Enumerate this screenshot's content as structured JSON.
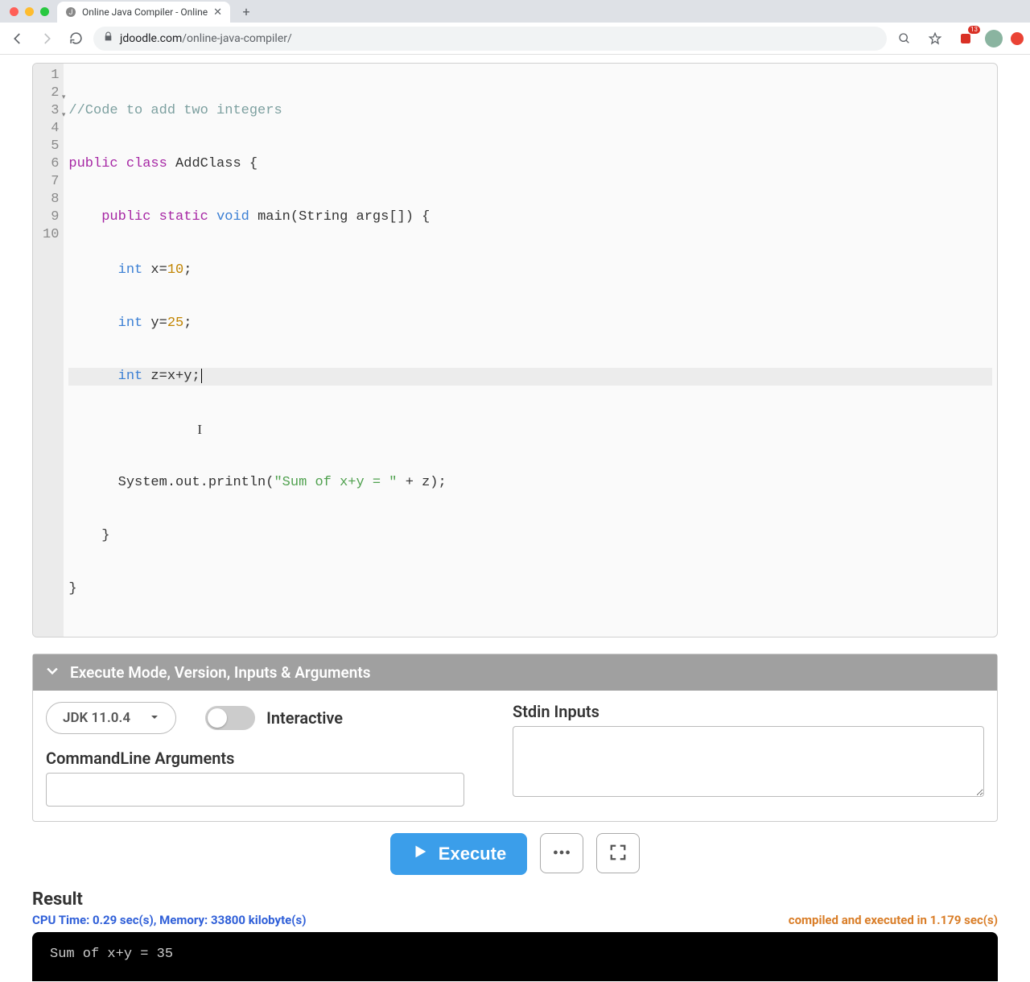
{
  "browser": {
    "tab_title": "Online Java Compiler - Online",
    "url_display_pre": "jdoodle.com",
    "url_display_post": "/online-java-compiler/"
  },
  "editor": {
    "lines": [
      {
        "n": "1"
      },
      {
        "n": "2"
      },
      {
        "n": "3"
      },
      {
        "n": "4"
      },
      {
        "n": "5"
      },
      {
        "n": "6"
      },
      {
        "n": "7"
      },
      {
        "n": "8"
      },
      {
        "n": "9"
      },
      {
        "n": "10"
      }
    ],
    "code": {
      "l1_comment": "//Code to add two integers",
      "l2_kw_public": "public",
      "l2_kw_class": "class",
      "l2_id": "AddClass",
      "l2_brace": " {",
      "l3_indent": "    ",
      "l3_kw_public": "public",
      "l3_kw_static": "static",
      "l3_kw_void": "void",
      "l3_main": " main(",
      "l3_string": "String",
      "l3_args": " args[]) {",
      "l4_indent": "      ",
      "l4_int": "int",
      "l4_rest": " x=",
      "l4_num": "10",
      "l4_semi": ";",
      "l5_indent": "      ",
      "l5_int": "int",
      "l5_rest": " y=",
      "l5_num": "25",
      "l5_semi": ";",
      "l6_indent": "      ",
      "l6_int": "int",
      "l6_rest": " z=x+y;",
      "l8_indent": "      ",
      "l8_sys": "System.out.println(",
      "l8_str": "\"Sum of x+y = \"",
      "l8_rest": " + z);",
      "l9_indent": "    ",
      "l9_brace": "}",
      "l10_brace": "}"
    }
  },
  "exec": {
    "header": "Execute Mode, Version, Inputs & Arguments",
    "jdk": "JDK 11.0.4",
    "interactive_label": "Interactive",
    "cli_label": "CommandLine Arguments",
    "stdin_label": "Stdin Inputs",
    "execute_label": "Execute"
  },
  "result": {
    "title": "Result",
    "meta_left": "CPU Time: 0.29 sec(s), Memory: 33800 kilobyte(s)",
    "meta_right": "compiled and executed in 1.179 sec(s)",
    "output": "Sum of x+y = 35"
  }
}
